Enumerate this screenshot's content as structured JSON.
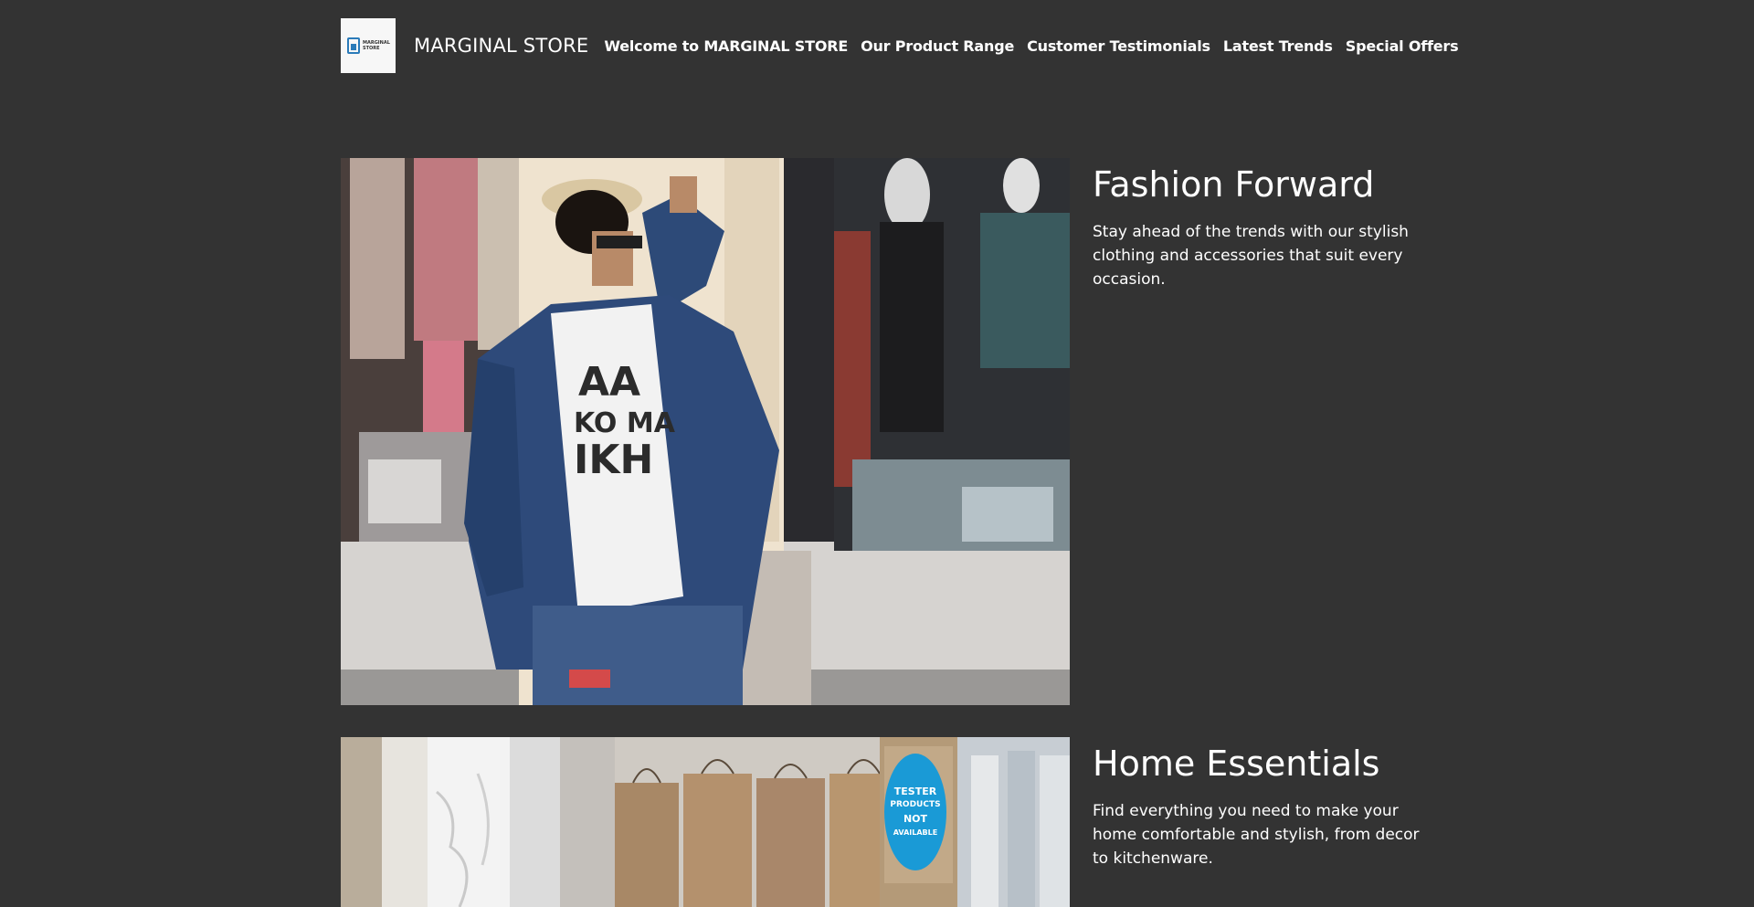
{
  "header": {
    "logo_text": [
      "MARGINAL",
      "STORE"
    ],
    "brand": "MARGINAL STORE",
    "nav": [
      "Welcome to MARGINAL STORE",
      "Our Product Range",
      "Customer Testimonials",
      "Latest Trends",
      "Special Offers"
    ]
  },
  "sections": [
    {
      "title": "Fashion Forward",
      "body": "Stay ahead of the trends with our stylish clothing and accessories that suit every occasion."
    },
    {
      "title": "Home Essentials",
      "body": "Find everything you need to make your home comfortable and stylish, from decor to kitchenware.",
      "sign_text": [
        "TESTER",
        "PRODUCTS",
        "NOT",
        "AVAILABLE"
      ]
    }
  ],
  "colors": {
    "background": "#333333",
    "text": "#ffffff",
    "logo_accent": "#2b7bb9",
    "sign_blue": "#1a9ad6"
  }
}
